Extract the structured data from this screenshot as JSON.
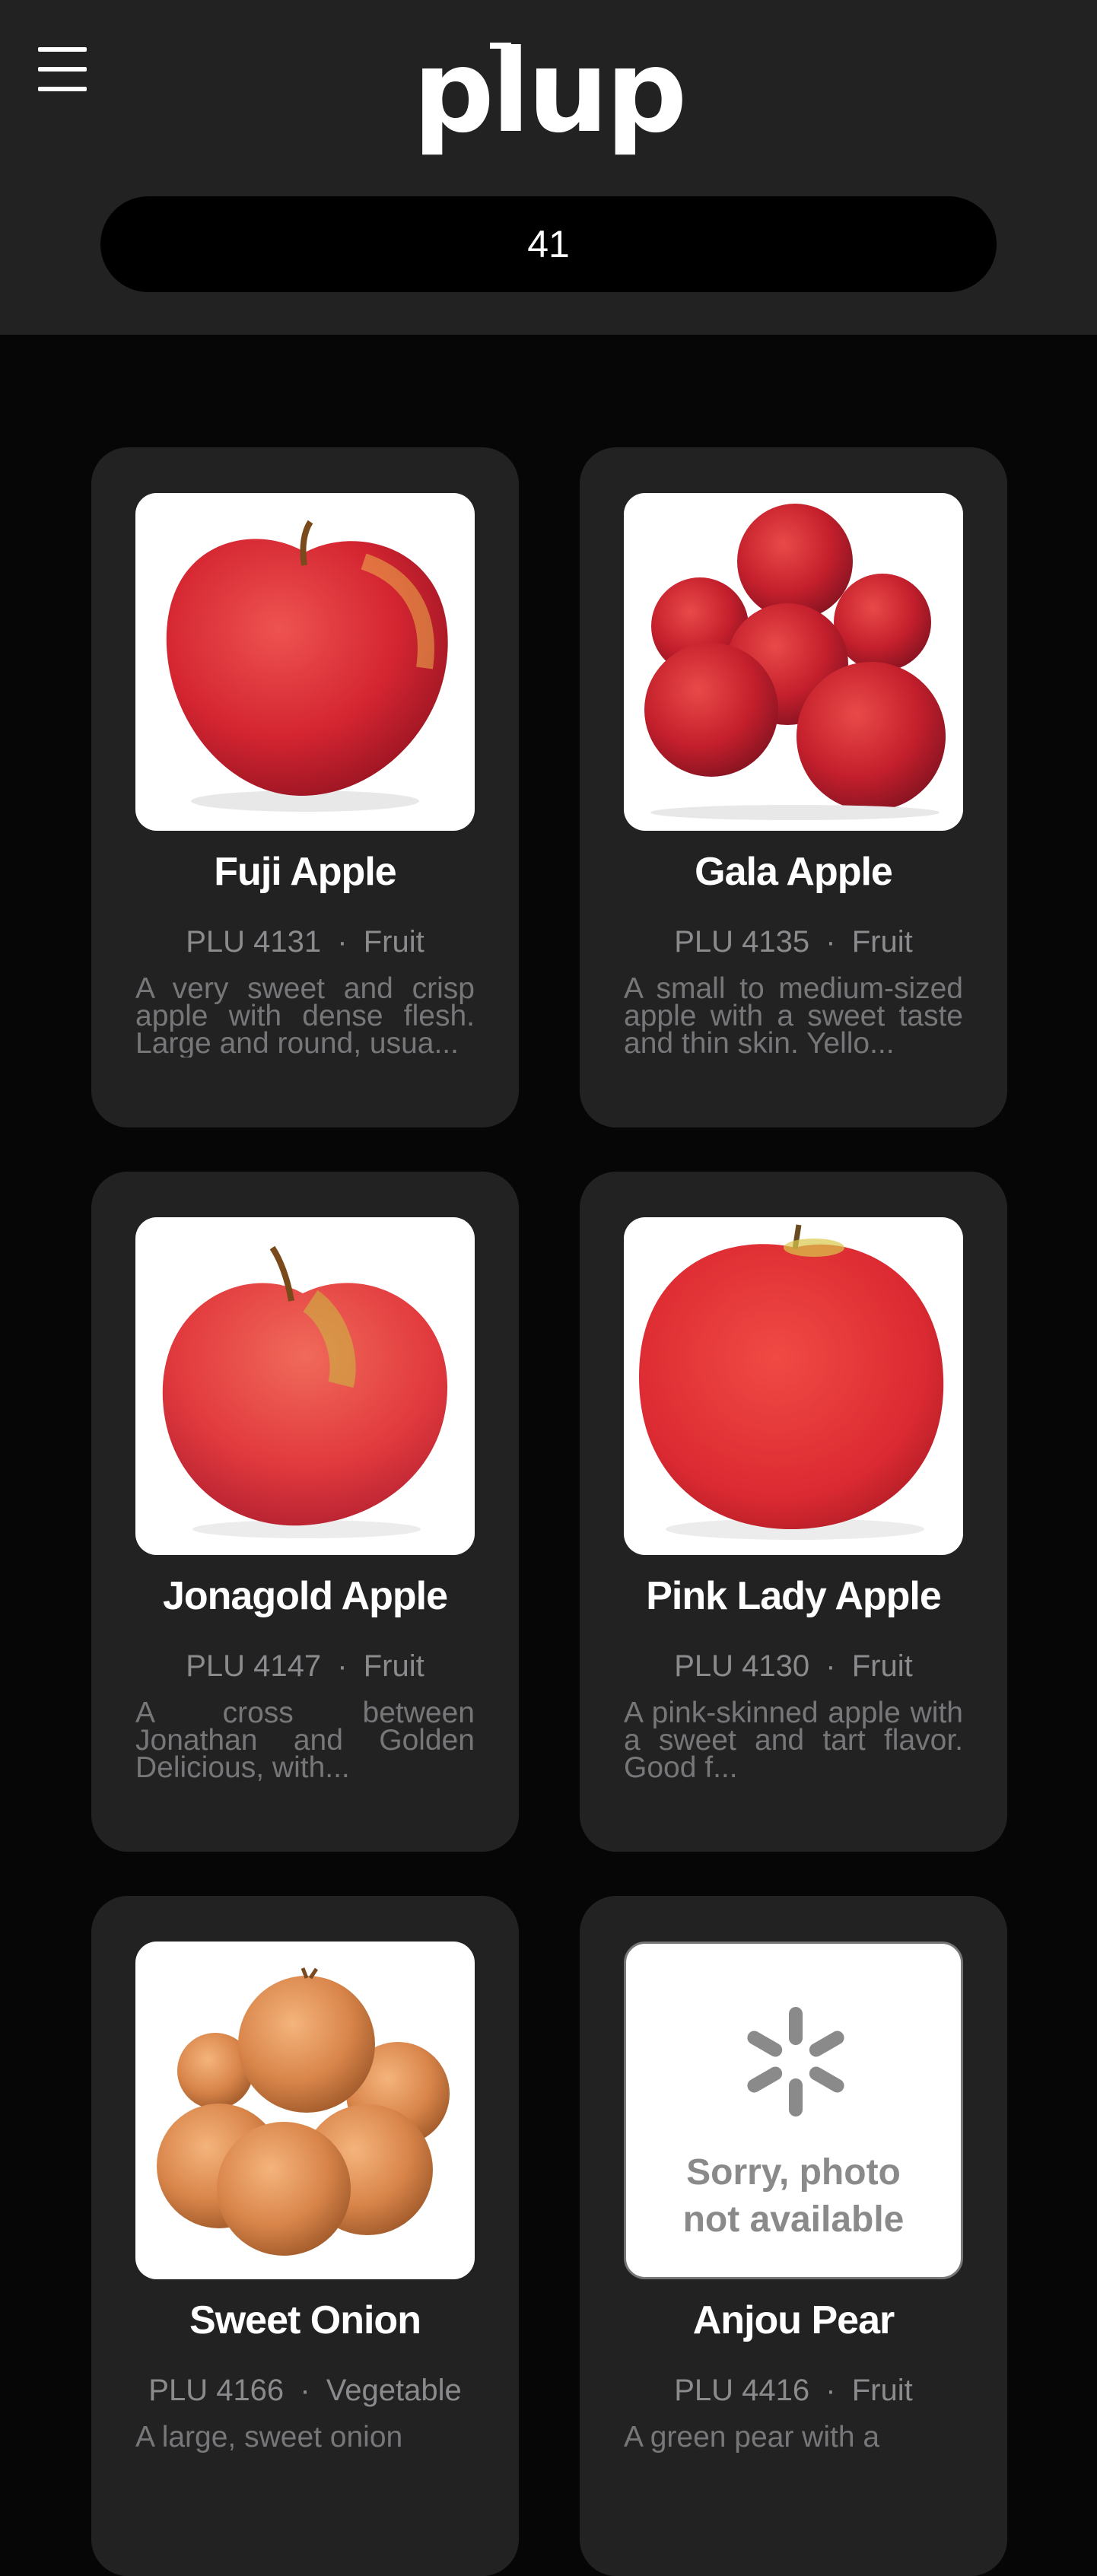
{
  "app": {
    "logo_text": "plup"
  },
  "search": {
    "value": "41"
  },
  "cards": [
    {
      "name": "Fuji Apple",
      "plu": "PLU 4131",
      "category": "Fruit",
      "description": "A very sweet and crisp apple with dense flesh. Large and round, usua...",
      "image": "fuji-apple-photo"
    },
    {
      "name": "Gala Apple",
      "plu": "PLU 4135",
      "category": "Fruit",
      "description": "A small to medium-sized apple with a sweet taste and thin skin. Yello...",
      "image": "gala-apples-photo"
    },
    {
      "name": "Jonagold Apple",
      "plu": "PLU 4147",
      "category": "Fruit",
      "description": "A cross between Jonathan and Golden Delicious, with...",
      "image": "jonagold-apple-photo"
    },
    {
      "name": "Pink Lady Apple",
      "plu": "PLU 4130",
      "category": "Fruit",
      "description": "A pink-skinned apple with a sweet and tart flavor. Good f...",
      "image": "pink-lady-apple-photo"
    },
    {
      "name": "Sweet Onion",
      "plu": "PLU 4166",
      "category": "Vegetable",
      "description": "A large, sweet onion",
      "image": "sweet-onions-photo"
    },
    {
      "name": "Anjou Pear",
      "plu": "PLU 4416",
      "category": "Fruit",
      "description": "A green pear with a",
      "image": "photo-unavailable-placeholder",
      "placeholder_line1": "Sorry, photo",
      "placeholder_line2": "not available"
    }
  ],
  "separator": "·",
  "colors": {
    "header_bg": "#222223",
    "page_bg": "#060607",
    "card_bg": "#222223",
    "search_bg": "#000000",
    "apple_red": "#d8232f",
    "onion": "#d9854a",
    "placeholder_gray": "#8a8a8a"
  }
}
